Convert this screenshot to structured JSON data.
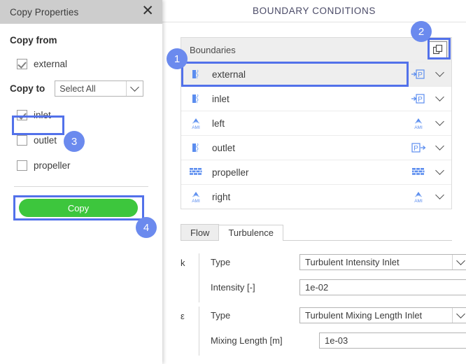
{
  "dialog": {
    "title": "Copy Properties",
    "close_icon": "close-icon",
    "copy_from_title": "Copy from",
    "copy_from_items": [
      {
        "label": "external",
        "checked": true
      }
    ],
    "copy_to_title": "Copy to",
    "copy_to_select_value": "Select All",
    "copy_to_items": [
      {
        "label": "inlet",
        "checked": true
      },
      {
        "label": "outlet",
        "checked": false
      },
      {
        "label": "propeller",
        "checked": false
      }
    ],
    "copy_button_label": "Copy",
    "copy_button_color": "#3dc63d"
  },
  "panel": {
    "title": "BOUNDARY CONDITIONS",
    "list_header": "Boundaries",
    "copy_icon": "copy-icon",
    "boundaries": [
      {
        "name": "external",
        "icon": "patch-icon",
        "type_icon": "pressure-inlet-icon",
        "selected": true
      },
      {
        "name": "inlet",
        "icon": "patch-icon",
        "type_icon": "pressure-inlet-icon",
        "selected": false
      },
      {
        "name": "left",
        "icon": "ami-icon",
        "type_icon": "ami-icon",
        "selected": false
      },
      {
        "name": "outlet",
        "icon": "patch-icon",
        "type_icon": "pressure-outlet-icon",
        "selected": false
      },
      {
        "name": "propeller",
        "icon": "wall-icon",
        "type_icon": "wall-icon",
        "selected": false
      },
      {
        "name": "right",
        "icon": "ami-icon",
        "type_icon": "ami-icon",
        "selected": false
      }
    ]
  },
  "tabs": [
    {
      "label": "Flow",
      "active": false
    },
    {
      "label": "Turbulence",
      "active": true
    }
  ],
  "form": {
    "groups": [
      {
        "symbol": "k",
        "fields": [
          {
            "label": "Type",
            "value": "Turbulent Intensity Inlet",
            "kind": "select"
          },
          {
            "label": "Intensity [-]",
            "value": "1e-02",
            "kind": "text"
          }
        ]
      },
      {
        "symbol": "ε",
        "fields": [
          {
            "label": "Type",
            "value": "Turbulent Mixing Length Inlet",
            "kind": "select"
          },
          {
            "label": "Mixing Length [m]",
            "value": "1e-03",
            "kind": "text"
          }
        ]
      }
    ]
  },
  "annotations": {
    "accent_color": "#5271ea",
    "badge_color": "#6b8aee",
    "badges": [
      {
        "number": "1"
      },
      {
        "number": "2"
      },
      {
        "number": "3"
      },
      {
        "number": "4"
      }
    ]
  }
}
